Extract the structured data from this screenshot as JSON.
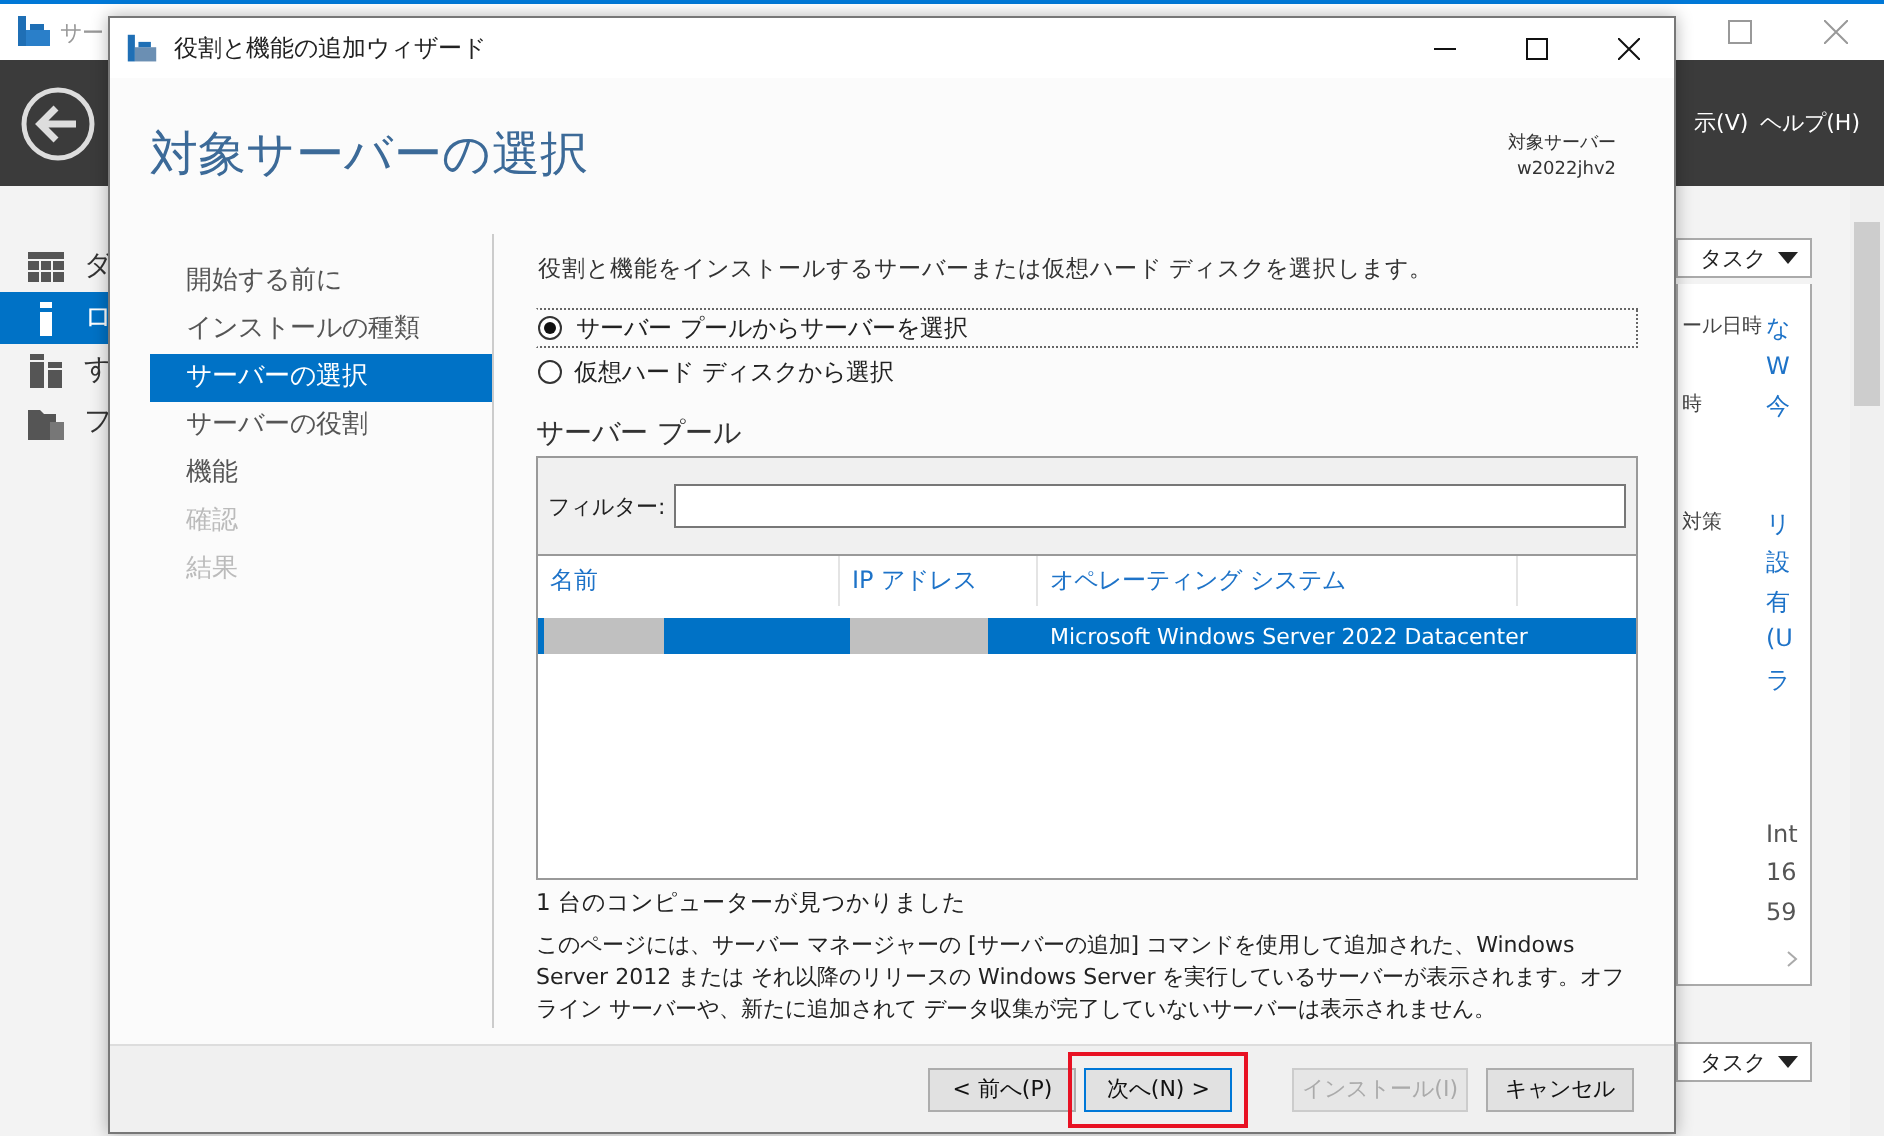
{
  "background_window": {
    "title": "サー",
    "menu": [
      {
        "label": "示(V)"
      },
      {
        "label": "ヘルプ(H)"
      }
    ],
    "nav": [
      {
        "label": "ダ",
        "kind": "dashboard",
        "selected": false
      },
      {
        "label": "ロ",
        "kind": "local",
        "selected": true
      },
      {
        "label": "す",
        "kind": "all",
        "selected": false
      },
      {
        "label": "フ",
        "kind": "files",
        "selected": false
      }
    ],
    "tasks_top": "タスク",
    "rows": [
      {
        "label": "ール日時",
        "value": "な"
      },
      {
        "value": "W"
      },
      {
        "label": "時",
        "value": "今"
      },
      {
        "label": "対策",
        "value": "リ"
      },
      {
        "value": "設"
      },
      {
        "value": "有"
      },
      {
        "value": "(U"
      },
      {
        "value": "ラ"
      },
      {
        "value": "Int",
        "plain": true
      },
      {
        "value": "16",
        "plain": true
      },
      {
        "value": "59",
        "plain": true
      }
    ],
    "tasks_bottom": "タスク"
  },
  "dialog": {
    "title": "役割と機能の追加ウィザード",
    "heading": "対象サーバーの選択",
    "target_label": "対象サーバー",
    "target_name": "w2022jhv2",
    "steps": [
      {
        "label": "開始する前に",
        "selected": false,
        "disabled": false
      },
      {
        "label": "インストールの種類",
        "selected": false,
        "disabled": false
      },
      {
        "label": "サーバーの選択",
        "selected": true,
        "disabled": false
      },
      {
        "label": "サーバーの役割",
        "selected": false,
        "disabled": false
      },
      {
        "label": "機能",
        "selected": false,
        "disabled": false
      },
      {
        "label": "確認",
        "selected": false,
        "disabled": true
      },
      {
        "label": "結果",
        "selected": false,
        "disabled": true
      }
    ],
    "intro": "役割と機能をインストールするサーバーまたは仮想ハード ディスクを選択します。",
    "options": [
      {
        "label": "サーバー プールからサーバーを選択",
        "selected": true,
        "focused": true
      },
      {
        "label": "仮想ハード ディスクから選択",
        "selected": false,
        "focused": false
      }
    ],
    "pool_heading": "サーバー プール",
    "filter_label": "フィルター:",
    "columns": [
      "名前",
      "IP アドレス",
      "オペレーティング システム"
    ],
    "rows": [
      {
        "os": "Microsoft Windows Server 2022 Datacenter",
        "selected": true
      }
    ],
    "count": "1 台のコンピューターが見つかりました",
    "note": "このページには、サーバー マネージャーの [サーバーの追加] コマンドを使用して追加された、Windows Server 2012 または それ以降のリリースの Windows Server を実行しているサーバーが表示されます。オフライン サーバーや、新たに追加されて データ収集が完了していないサーバーは表示されません。",
    "buttons": [
      {
        "label": "< 前へ(P)",
        "disabled": false,
        "focused": false,
        "highlighted": false
      },
      {
        "label": "次へ(N) >",
        "disabled": false,
        "focused": true,
        "highlighted": true
      },
      {
        "label": "インストール(I)",
        "disabled": true,
        "focused": false,
        "highlighted": false
      },
      {
        "label": "キャンセル",
        "disabled": false,
        "focused": false,
        "highlighted": false
      }
    ]
  }
}
